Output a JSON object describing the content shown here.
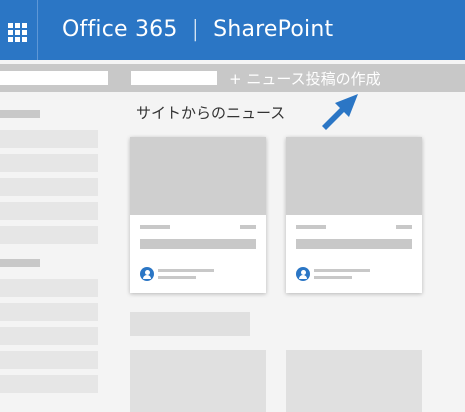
{
  "suite_bar": {
    "app_name": "Office 365",
    "separator": "|",
    "site_name": "SharePoint",
    "waffle_icon": "app-launcher-icon",
    "color": "#2b76c5"
  },
  "command_bar": {
    "new_post_label": "+ ニュース投稿の作成",
    "color": "#c8c8c8"
  },
  "main": {
    "section_title": "サイトからのニュース",
    "arrow_icon": "pointer-arrow-icon",
    "accent": "#2b76c5"
  }
}
